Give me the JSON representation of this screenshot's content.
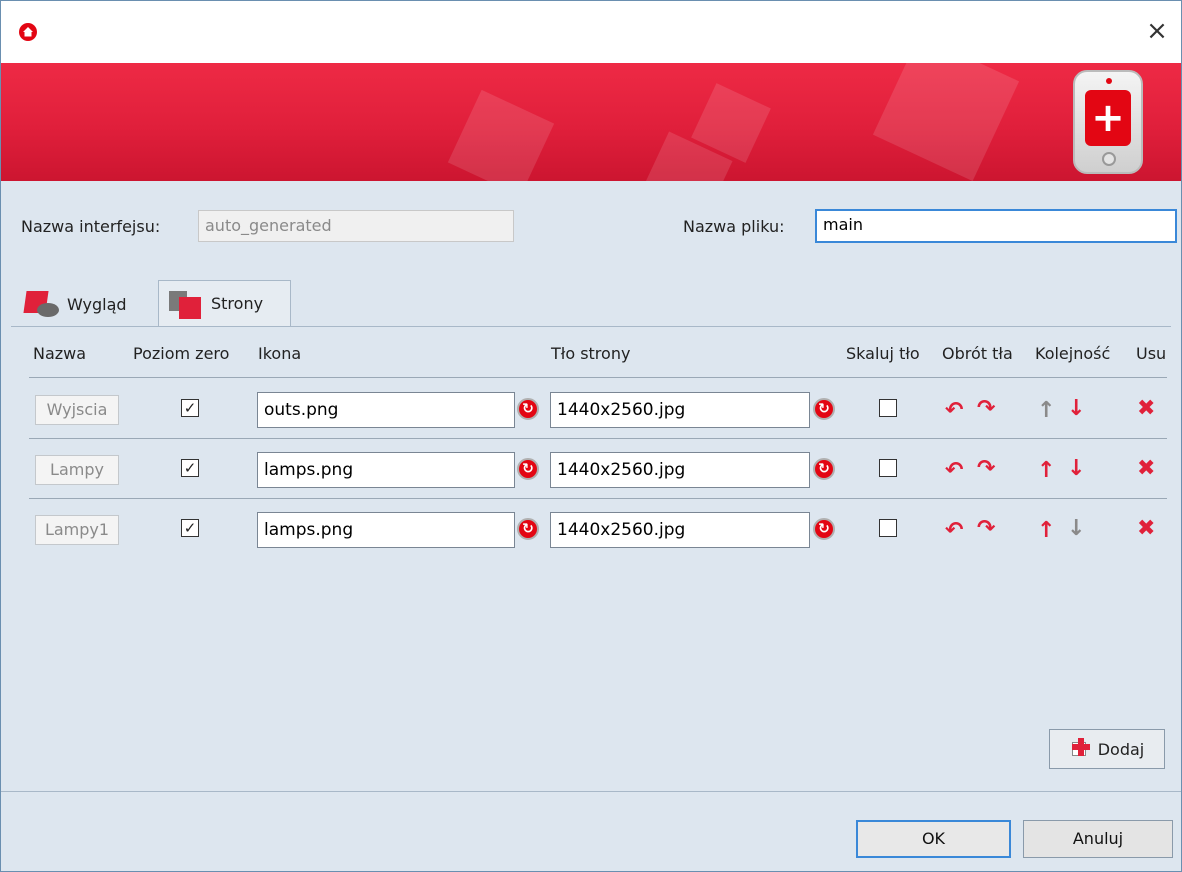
{
  "window": {
    "close_glyph": "×"
  },
  "form": {
    "interface_name_label": "Nazwa interfejsu:",
    "interface_name_value": "auto_generated",
    "file_name_label": "Nazwa pliku:",
    "file_name_value": "main"
  },
  "tabs": [
    {
      "label": "Wygląd",
      "active": false,
      "icon": "appearance-icon"
    },
    {
      "label": "Strony",
      "active": true,
      "icon": "pages-icon"
    }
  ],
  "columns": {
    "name": "Nazwa",
    "level_zero": "Poziom zero",
    "icon": "Ikona",
    "background": "Tło strony",
    "scale_bg": "Skaluj tło",
    "rotate_bg": "Obrót tła",
    "order": "Kolejność",
    "delete": "Usu"
  },
  "rows": [
    {
      "name": "Wyjscia",
      "level_zero": true,
      "icon": "outs.png",
      "background": "1440x2560.jpg",
      "scale_bg": false,
      "up_enabled": false,
      "down_enabled": true
    },
    {
      "name": "Lampy",
      "level_zero": true,
      "icon": "lamps.png",
      "background": "1440x2560.jpg",
      "scale_bg": false,
      "up_enabled": true,
      "down_enabled": true
    },
    {
      "name": "Lampy1",
      "level_zero": true,
      "icon": "lamps.png",
      "background": "1440x2560.jpg",
      "scale_bg": false,
      "up_enabled": true,
      "down_enabled": false
    }
  ],
  "buttons": {
    "add": "Dodaj",
    "ok": "OK",
    "cancel": "Anuluj"
  },
  "colors": {
    "accent_red": "#e30613",
    "focus_blue": "#3a88d8"
  }
}
